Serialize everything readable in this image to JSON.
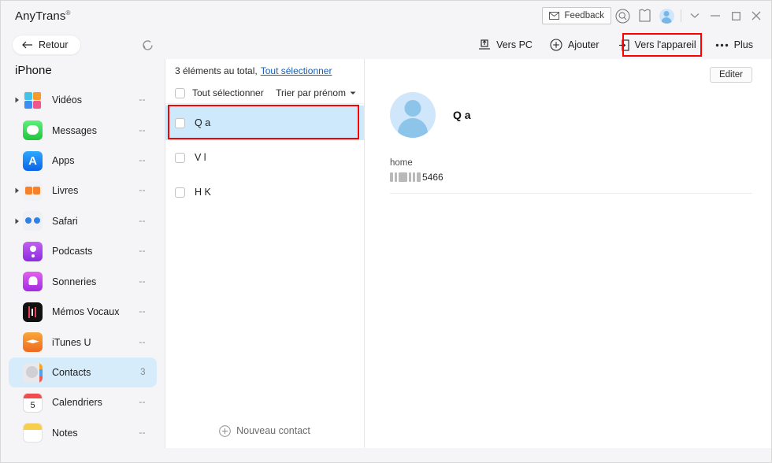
{
  "titlebar": {
    "app_title": "AnyTrans",
    "trademark": "®",
    "feedback_label": "Feedback",
    "icons": {
      "envelope": "envelope-icon",
      "search": "search-icon",
      "shirt": "shirt-icon",
      "avatar": "user-avatar-icon",
      "chevron_down": "chevron-down-icon",
      "minimize": "minimize-icon",
      "maximize": "maximize-icon",
      "close": "close-icon"
    }
  },
  "toolbar": {
    "back_label": "Retour",
    "refresh_icon": "refresh-icon",
    "actions": [
      {
        "label": "Vers PC",
        "icon": "export-to-pc-icon",
        "highlighted": false
      },
      {
        "label": "Ajouter",
        "icon": "plus-circle-icon",
        "highlighted": false
      },
      {
        "label": "Vers l'appareil",
        "icon": "send-to-device-icon",
        "highlighted": true
      },
      {
        "label": "Plus",
        "icon": "more-dots-icon",
        "highlighted": false
      }
    ]
  },
  "sidebar": {
    "device_name": "iPhone",
    "items": [
      {
        "label": "Vidéos",
        "count": "--",
        "expandable": true,
        "active": false,
        "icon": "videos-icon"
      },
      {
        "label": "Messages",
        "count": "--",
        "expandable": false,
        "active": false,
        "icon": "messages-icon"
      },
      {
        "label": "Apps",
        "count": "--",
        "expandable": false,
        "active": false,
        "icon": "apps-icon"
      },
      {
        "label": "Livres",
        "count": "--",
        "expandable": true,
        "active": false,
        "icon": "books-icon"
      },
      {
        "label": "Safari",
        "count": "--",
        "expandable": true,
        "active": false,
        "icon": "safari-icon"
      },
      {
        "label": "Podcasts",
        "count": "--",
        "expandable": false,
        "active": false,
        "icon": "podcasts-icon"
      },
      {
        "label": "Sonneries",
        "count": "--",
        "expandable": false,
        "active": false,
        "icon": "ringtones-icon"
      },
      {
        "label": "Mémos Vocaux",
        "count": "--",
        "expandable": false,
        "active": false,
        "icon": "voice-memos-icon"
      },
      {
        "label": "iTunes U",
        "count": "--",
        "expandable": false,
        "active": false,
        "icon": "itunes-u-icon"
      },
      {
        "label": "Contacts",
        "count": "3",
        "expandable": false,
        "active": true,
        "icon": "contacts-icon"
      },
      {
        "label": "Calendriers",
        "count": "--",
        "expandable": false,
        "active": false,
        "icon": "calendar-icon",
        "icon_day": "5"
      },
      {
        "label": "Notes",
        "count": "--",
        "expandable": false,
        "active": false,
        "icon": "notes-icon"
      }
    ]
  },
  "list": {
    "total_text": "3 éléments au total,",
    "select_all_link": "Tout sélectionner",
    "select_all_checkbox_label": "Tout sélectionner",
    "sort_label": "Trier par prénom",
    "new_contact_label": "Nouveau contact",
    "contacts": [
      {
        "name": "Q a",
        "selected": true,
        "highlighted": true
      },
      {
        "name": "V l",
        "selected": false,
        "highlighted": false
      },
      {
        "name": "H K",
        "selected": false,
        "highlighted": false
      }
    ]
  },
  "detail": {
    "edit_label": "Editer",
    "contact_name": "Q a",
    "field_label": "home",
    "phone_visible_suffix": "5466"
  },
  "colors": {
    "accent_blue": "#cde9fb",
    "sidebar_active": "#d6ecfb",
    "annotation_red": "#ff0000",
    "link_blue": "#1a5fb4",
    "background": "#f5f5f7"
  }
}
